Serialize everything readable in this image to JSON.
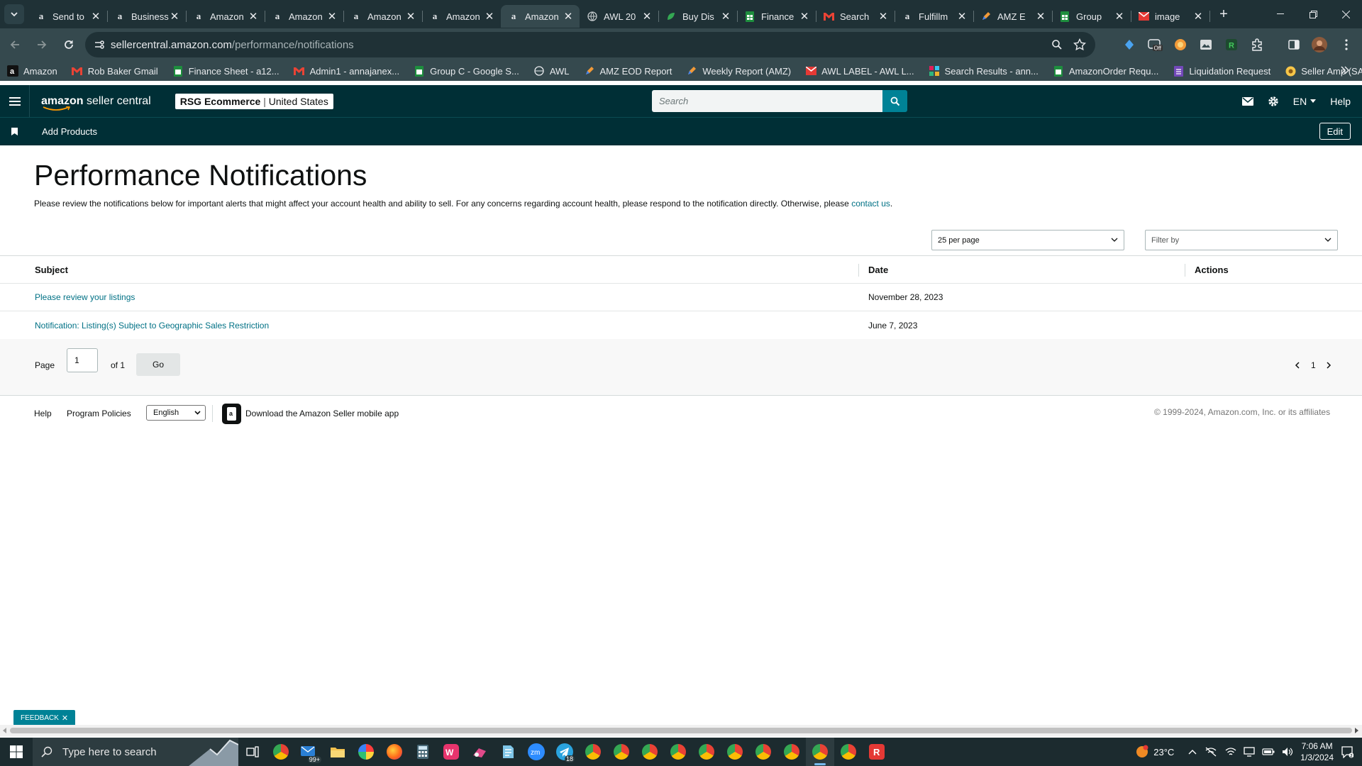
{
  "browser": {
    "tabs": [
      {
        "title": "Send to",
        "icon": "amazon"
      },
      {
        "title": "Business",
        "icon": "amazon"
      },
      {
        "title": "Amazon",
        "icon": "amazon"
      },
      {
        "title": "Amazon",
        "icon": "amazon"
      },
      {
        "title": "Amazon",
        "icon": "amazon"
      },
      {
        "title": "Amazon",
        "icon": "amazon"
      },
      {
        "title": "Amazon",
        "icon": "amazon",
        "active": true
      },
      {
        "title": "AWL 20",
        "icon": "globe"
      },
      {
        "title": "Buy Dis",
        "icon": "leaf"
      },
      {
        "title": "Finance",
        "icon": "sheets"
      },
      {
        "title": "Search",
        "icon": "gmail"
      },
      {
        "title": "Fulfillm",
        "icon": "amazon"
      },
      {
        "title": "AMZ E",
        "icon": "pen"
      },
      {
        "title": "Group",
        "icon": "sheets"
      },
      {
        "title": "image",
        "icon": "flag"
      }
    ],
    "url_host": "sellercentral.amazon.com",
    "url_path": "/performance/notifications",
    "bookmarks": [
      "Amazon",
      "Rob Baker Gmail",
      "Finance Sheet - a12...",
      "Admin1 - annajanex...",
      "Group C - Google S...",
      "AWL",
      "AMZ EOD Report",
      "Weekly Report (AMZ)",
      "AWL LABEL - AWL L...",
      "Search Results - ann...",
      "AmazonOrder Requ...",
      "Liquidation Request",
      "Seller Amp (SAS)"
    ]
  },
  "header": {
    "logo_brand": "amazon",
    "logo_rest": " seller central",
    "account_name": "RSG Ecommerce",
    "account_region": "United States",
    "search_placeholder": "Search",
    "language": "EN",
    "help": "Help",
    "add_products": "Add Products",
    "edit": "Edit"
  },
  "page": {
    "title": "Performance Notifications",
    "intro": "Please review the notifications below for important alerts that might affect your account health and ability to sell. For any concerns regarding account health, please respond to the notification directly. Otherwise, please ",
    "contact_link": "contact us",
    "intro_end": ".",
    "per_page": "25 per page",
    "filter": "Filter by",
    "columns": {
      "subject": "Subject",
      "date": "Date",
      "actions": "Actions"
    },
    "rows": [
      {
        "subject": "Please review your listings",
        "date": "November 28, 2023"
      },
      {
        "subject": "Notification: Listing(s) Subject to Geographic Sales Restriction",
        "date": "June 7, 2023"
      }
    ],
    "pager": {
      "label": "Page",
      "value": "1",
      "of": "of 1",
      "go": "Go",
      "current": "1"
    }
  },
  "footer": {
    "help": "Help",
    "policies": "Program Policies",
    "language": "English",
    "app": "Download the Amazon Seller mobile app",
    "copyright": "© 1999-2024, Amazon.com, Inc. or its affiliates"
  },
  "feedback": "FEEDBACK",
  "taskbar": {
    "search_placeholder": "Type here to search",
    "mail_badge": "99+",
    "telegram_badge": "18",
    "weather": "23°C",
    "time": "7:06 AM",
    "date": "1/3/2024"
  },
  "colors": {
    "header": "#002f36",
    "link": "#007185",
    "accent": "#008296"
  }
}
